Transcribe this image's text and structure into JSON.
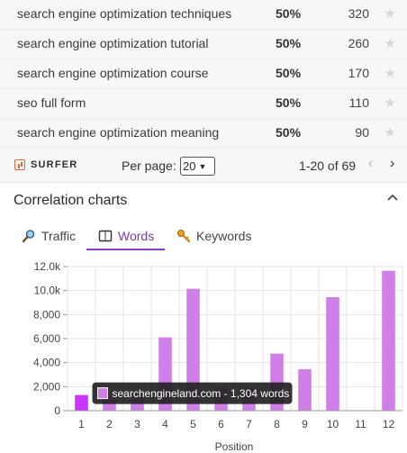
{
  "keyword_rows": [
    {
      "keyword": "search engine optimization techniques",
      "difficulty": "50%",
      "volume": "320"
    },
    {
      "keyword": "search engine optimization tutorial",
      "difficulty": "50%",
      "volume": "260"
    },
    {
      "keyword": "search engine optimization course",
      "difficulty": "50%",
      "volume": "170"
    },
    {
      "keyword": "seo full form",
      "difficulty": "50%",
      "volume": "110"
    },
    {
      "keyword": "search engine optimization meaning",
      "difficulty": "50%",
      "volume": "90"
    }
  ],
  "pager": {
    "logo_text": "SURFER",
    "per_page_label": "Per page:",
    "per_page_value": "20",
    "range_text": "1-20 of 69"
  },
  "correlation": {
    "title": "Correlation charts",
    "tabs": [
      {
        "label": "Traffic",
        "icon": "magnifier-icon"
      },
      {
        "label": "Words",
        "icon": "book-icon",
        "active": true
      },
      {
        "label": "Keywords",
        "icon": "key-icon"
      }
    ]
  },
  "colors": {
    "bar": "#d07ee8",
    "bar_highlight": "#cc33ff",
    "tab_active": "#8a3fc4",
    "tooltip_bg": "#222222"
  },
  "chart_data": {
    "type": "bar",
    "xlabel": "Position",
    "ylabel": "",
    "categories": [
      "1",
      "2",
      "3",
      "4",
      "5",
      "6",
      "7",
      "8",
      "9",
      "10",
      "11",
      "12"
    ],
    "values": [
      1304,
      1000,
      1000,
      6100,
      10150,
      1900,
      1900,
      4750,
      3450,
      9450,
      0,
      11650
    ],
    "ylim": [
      0,
      12000
    ],
    "yticks": [
      0,
      2000,
      4000,
      6000,
      8000,
      10000,
      12000
    ],
    "ytick_labels": [
      "0",
      "2,000",
      "4,000",
      "6,000",
      "8,000",
      "10.0k",
      "12.0k"
    ],
    "highlight_index": 0,
    "tooltip": "searchengineland.com - 1,304 words",
    "grid": true
  }
}
